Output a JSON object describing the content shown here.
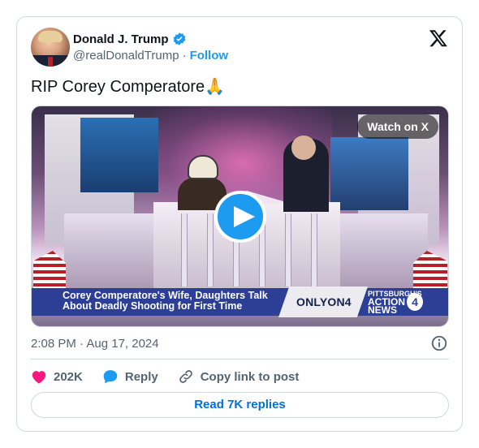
{
  "author": {
    "name": "Donald J. Trump",
    "handle": "@realDonaldTrump",
    "separator": "·",
    "follow_label": "Follow"
  },
  "tweet": {
    "text": "RIP Corey Comperatore🙏"
  },
  "media": {
    "watch_label": "Watch on X",
    "caption": "Corey Comperatore's Wife, Daughters Talk About Deadly Shooting for First Time",
    "badge": "ONLYON4",
    "station_small": "PITTSBURGH'S",
    "station_big": "ACTION NEWS",
    "station_number": "4"
  },
  "timestamp": "2:08 PM · Aug 17, 2024",
  "actions": {
    "likes": "202K",
    "reply_label": "Reply",
    "copy_label": "Copy link to post"
  },
  "read_replies_label": "Read 7K replies",
  "colors": {
    "accent": "#1d9bf0",
    "like": "#f91880",
    "link": "#006fd6",
    "muted": "#536471",
    "border": "#cfd9de"
  },
  "icons": [
    "verified-badge-icon",
    "x-logo-icon",
    "play-icon",
    "info-icon",
    "heart-icon",
    "reply-bubble-icon",
    "link-icon"
  ]
}
